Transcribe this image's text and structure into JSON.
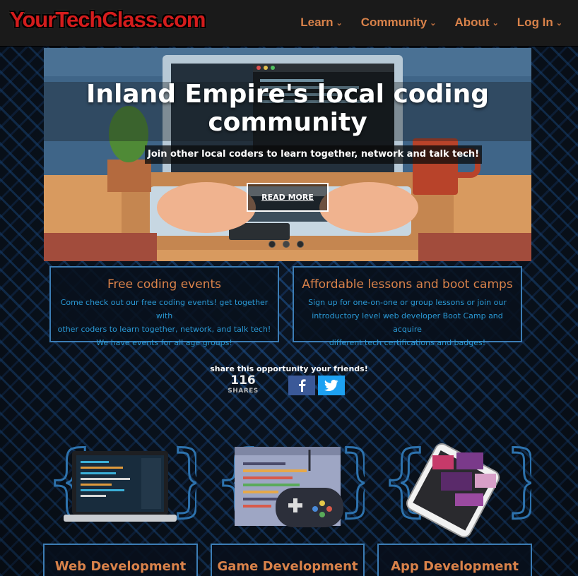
{
  "header": {
    "logo": "YourTechClass.com",
    "nav": [
      {
        "label": "Learn"
      },
      {
        "label": "Community"
      },
      {
        "label": "About"
      },
      {
        "label": "Log In"
      }
    ]
  },
  "hero": {
    "title_line1": "Inland Empire's local coding",
    "title_line2": "community",
    "subtitle": "Join other local coders to learn together, network and talk tech!",
    "cta": "READ MORE"
  },
  "features": [
    {
      "title": "Free coding events",
      "lines": [
        "Come check out our free coding events! get together with",
        "other coders to learn together, network, and talk tech!",
        "We have events for all age groups!"
      ]
    },
    {
      "title": "Affordable lessons and boot camps",
      "lines": [
        "Sign up for one-on-one or group lessons or join our",
        "introductory level web developer Boot Camp and acquire",
        "different tech certifications and badges!"
      ]
    }
  ],
  "share": {
    "prompt": "share this opportunity your friends!",
    "count": "116",
    "count_label": "SHARES",
    "facebook_icon": "facebook-icon",
    "twitter_icon": "twitter-icon"
  },
  "services": [
    {
      "label": "Web Development"
    },
    {
      "label": "Game Development"
    },
    {
      "label": "App Development"
    }
  ],
  "colors": {
    "accent_orange": "#d9824a",
    "link_blue": "#2a9ad6",
    "border_blue": "#3c7db5",
    "logo_red": "#d41c1c"
  }
}
